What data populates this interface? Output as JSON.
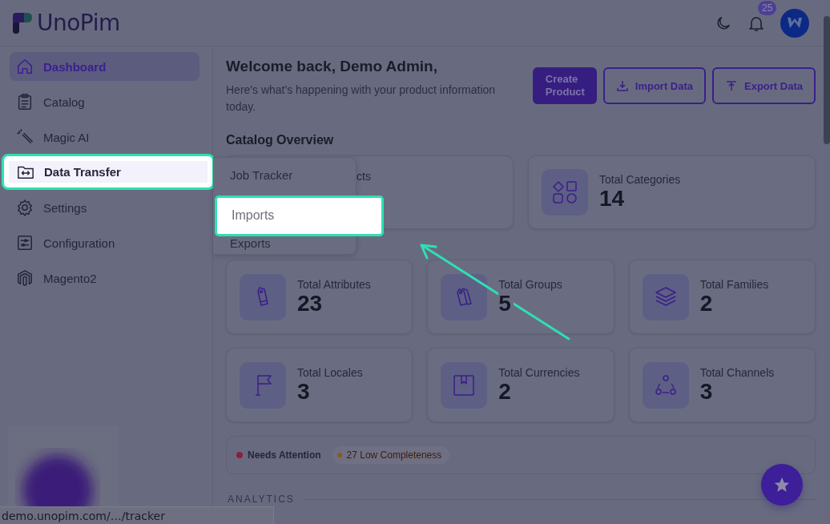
{
  "header": {
    "logo": "UnoPim",
    "notifications": "25"
  },
  "sidebar": {
    "items": [
      {
        "label": "Dashboard",
        "kind": "home",
        "selected": true,
        "highlighted": false
      },
      {
        "label": "Catalog",
        "kind": "clipboard",
        "selected": false,
        "highlighted": false
      },
      {
        "label": "Magic AI",
        "kind": "wand",
        "selected": false,
        "highlighted": false
      },
      {
        "label": "Data Transfer",
        "kind": "folder",
        "selected": false,
        "highlighted": true
      },
      {
        "label": "Settings",
        "kind": "gear",
        "selected": false,
        "highlighted": false
      },
      {
        "label": "Configuration",
        "kind": "sliders",
        "selected": false,
        "highlighted": false
      },
      {
        "label": "Magento2",
        "kind": "magento",
        "selected": false,
        "highlighted": false
      }
    ]
  },
  "submenu": {
    "items": [
      {
        "label": "Job Tracker",
        "highlighted": false
      },
      {
        "label": "Imports",
        "highlighted": true
      },
      {
        "label": "Exports",
        "highlighted": false
      }
    ]
  },
  "welcome": {
    "title": "Welcome back, Demo Admin,",
    "subtitle": "Here's what's happening with your product information today."
  },
  "actions": [
    {
      "label": "Create Product",
      "kind": "primary"
    },
    {
      "label": "Import Data",
      "kind": "import"
    },
    {
      "label": "Export Data",
      "kind": "export"
    }
  ],
  "overview": {
    "title": "Catalog Overview",
    "top_cards": [
      {
        "label": "cts",
        "kind": "covered"
      },
      {
        "label": "Total Categories",
        "value": "14",
        "kind": "shapes"
      }
    ],
    "cards": [
      {
        "label": "Total Attributes",
        "value": "23",
        "kind": "tag"
      },
      {
        "label": "Total Groups",
        "value": "5",
        "kind": "tags"
      },
      {
        "label": "Total Families",
        "value": "2",
        "kind": "layers"
      },
      {
        "label": "Total Locales",
        "value": "3",
        "kind": "flag"
      },
      {
        "label": "Total Currencies",
        "value": "2",
        "kind": "book"
      },
      {
        "label": "Total Channels",
        "value": "3",
        "kind": "channels"
      }
    ]
  },
  "attention": {
    "title": "Needs Attention",
    "color": "#8a1f3a",
    "badges": [
      {
        "label": "27 Low Completeness",
        "color": "#8a5a1a"
      }
    ]
  },
  "section": "ANALYTICS",
  "status_url": "demo.unopim.com/…/tracker"
}
